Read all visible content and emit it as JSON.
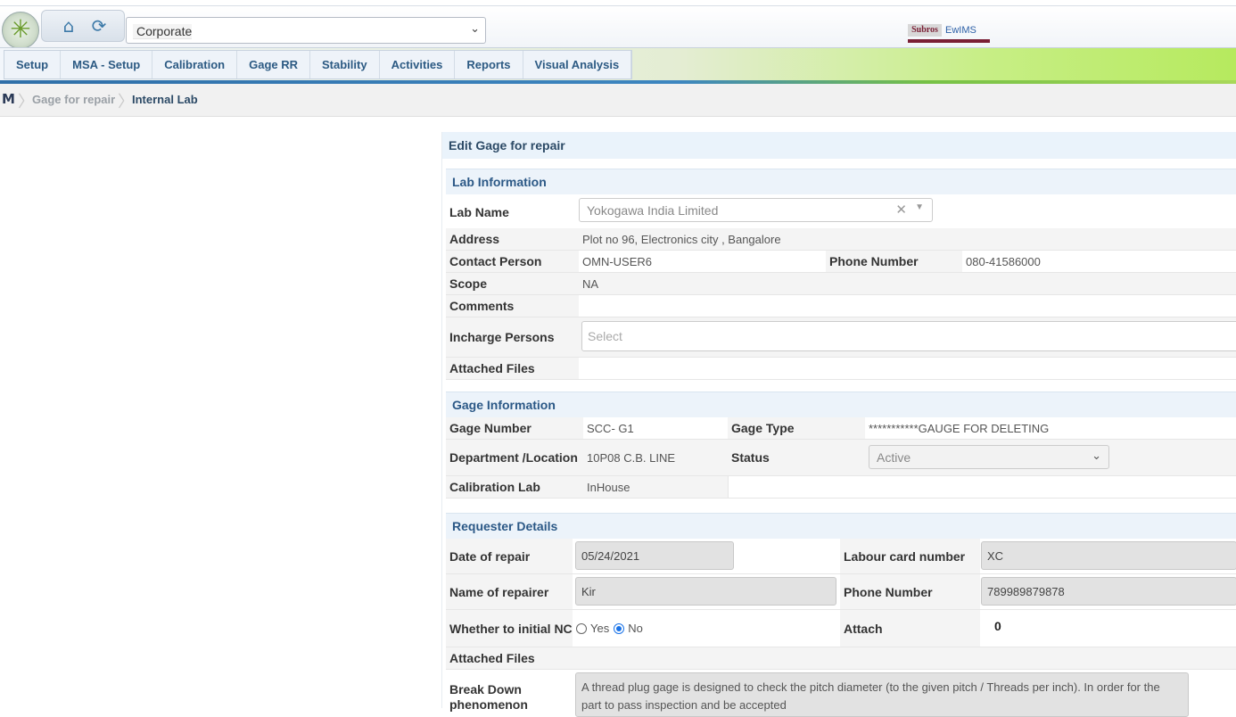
{
  "topbar": {
    "corporate_select_value": "Corporate",
    "logo_icon": "asterisk-logo-icon",
    "home_icon": "home-icon",
    "refresh_icon": "refresh-icon",
    "brand_left": "Subros",
    "brand_right": "EwIMS"
  },
  "menu": {
    "items": [
      "Setup",
      "MSA - Setup",
      "Calibration",
      "Gage RR",
      "Stability",
      "Activities",
      "Reports",
      "Visual Analysis"
    ]
  },
  "breadcrumb": {
    "home": "M",
    "items": [
      "Gage for repair",
      "Internal Lab"
    ]
  },
  "panel": {
    "title": "Edit Gage for repair",
    "lab": {
      "heading": "Lab Information",
      "lab_name_label": "Lab Name",
      "lab_name_value": "Yokogawa India Limited",
      "address_label": "Address",
      "address_value": "Plot no 96, Electronics city , Bangalore",
      "contact_label": "Contact Person",
      "contact_value": "OMN-USER6",
      "phone_label": "Phone Number",
      "phone_value": "080-41586000",
      "scope_label": "Scope",
      "scope_value": "NA",
      "comments_label": "Comments",
      "incharge_label": "Incharge Persons",
      "incharge_placeholder": "Select",
      "attached_label": "Attached Files"
    },
    "gage": {
      "heading": "Gage Information",
      "number_label": "Gage Number",
      "number_value": "SCC- G1",
      "type_label": "Gage Type",
      "type_value": "***********GAUGE FOR DELETING",
      "dept_label": "Department /Location",
      "dept_value": "10P08 C.B. LINE",
      "status_label": "Status",
      "status_value": "Active",
      "callab_label": "Calibration Lab",
      "callab_value": "InHouse"
    },
    "requester": {
      "heading": "Requester Details",
      "date_label": "Date of repair",
      "date_value": "05/24/2021",
      "labour_label": "Labour card number",
      "labour_value": "XC",
      "repairer_label": "Name of repairer",
      "repairer_value": "Kir",
      "phone_label": "Phone Number",
      "phone_value": "789989879878",
      "nc_label": "Whether to initial NC",
      "nc_yes": "Yes",
      "nc_no": "No",
      "nc_selected": "No",
      "attach_label": "Attach",
      "attach_icon": "paperclip-icon",
      "attached_label": "Attached Files",
      "breakdown_label": "Break Down phenomenon",
      "breakdown_value": "A thread plug gage is designed to check the pitch diameter (to the given pitch / Threads per inch). In order for the part to pass inspection and be accepted"
    }
  }
}
